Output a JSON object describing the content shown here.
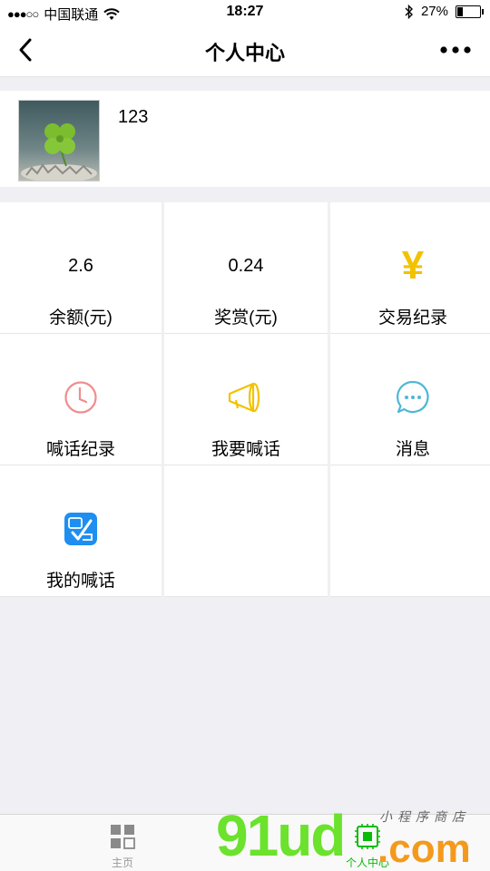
{
  "status_bar": {
    "signal": "●●●○○",
    "carrier": "中国联通",
    "time": "18:27",
    "battery_percent": "27%",
    "battery_level": 0.27
  },
  "nav": {
    "title": "个人中心"
  },
  "profile": {
    "username": "123"
  },
  "grid": {
    "balance_value": "2.6",
    "balance_label": "余额(元)",
    "reward_value": "0.24",
    "reward_label": "奖赏(元)",
    "transactions_symbol": "¥",
    "transactions_label": "交易纪录",
    "shout_record_label": "喊话纪录",
    "want_shout_label": "我要喊话",
    "messages_label": "消息",
    "my_shouts_label": "我的喊话"
  },
  "tabbar": {
    "home_label": "主页",
    "me_label": "个人中心"
  },
  "watermark": {
    "main": "91ud",
    "com": ".com",
    "small": "小程序商店"
  },
  "colors": {
    "accent_green": "#09bb07",
    "yen_gold": "#f2c200",
    "clock_pink": "#ef8d8d",
    "megaphone_gold": "#f2c200",
    "chat_teal": "#4fb7d6"
  }
}
